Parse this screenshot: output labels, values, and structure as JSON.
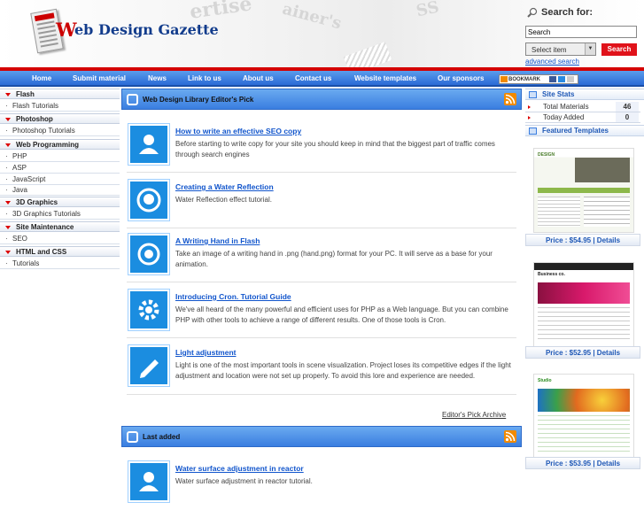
{
  "header": {
    "logo_w": "W",
    "logo_rest": "eb Design Gazette",
    "bg_words": [
      "ertise",
      "ainer's",
      "SS"
    ],
    "search_title": "Search for:",
    "search_value": "Search",
    "select_value": "Select item",
    "search_button": "Search",
    "advanced_search": "advanced search"
  },
  "nav": {
    "items": [
      "Home",
      "Submit material",
      "News",
      "Link to us",
      "About us",
      "Contact us",
      "Website templates",
      "Our sponsors"
    ],
    "bookmark": "BOOKMARK"
  },
  "sidebar": {
    "categories": [
      {
        "label": "Flash",
        "items": [
          "Flash Tutorials"
        ]
      },
      {
        "label": "Photoshop",
        "items": [
          "Photoshop Tutorials"
        ]
      },
      {
        "label": "Web Programming",
        "items": [
          "PHP",
          "ASP",
          "JavaScript",
          "Java"
        ]
      },
      {
        "label": "3D Graphics",
        "items": [
          "3D Graphics Tutorials"
        ]
      },
      {
        "label": "Site Maintenance",
        "items": [
          "SEO"
        ]
      },
      {
        "label": "HTML and CSS",
        "items": [
          "Tutorials"
        ]
      }
    ]
  },
  "main": {
    "editors_pick_title": "Web Design Library Editor's Pick",
    "articles": [
      {
        "title": "How to write an effective SEO copy",
        "desc": "Before starting to write copy for your site you should keep in mind that the biggest part of traffic comes through search engines",
        "icon": "user-icon"
      },
      {
        "title": "Creating a Water Reflection",
        "desc": "Water Reflection effect tutorial.",
        "icon": "face-icon"
      },
      {
        "title": "A Writing Hand in Flash",
        "desc": "Take an image of a writing hand in .png (hand.png) format for your PC. It will serve as a base for your animation.",
        "icon": "refresh-icon"
      },
      {
        "title": "Introducing Cron. Tutorial Guide",
        "desc": "We've all heard of the many powerful and efficient uses for PHP as a Web language. But you can combine PHP with other tools to achieve a range of different results. One of those tools is Cron.",
        "icon": "gear-icon"
      },
      {
        "title": "Light adjustment",
        "desc": "Light is one of the most important tools in scene visualization. Project loses its competitive edges if the light adjustment and location were not set up properly. To avoid this lore and experience are needed.",
        "icon": "pencil-icon"
      }
    ],
    "archive_link": "Editor's Pick Archive",
    "last_added_title": "Last added",
    "last_added": [
      {
        "title": "Water surface adjustment in reactor",
        "desc": "Water surface adjustment in reactor tutorial.",
        "icon": "user-icon"
      }
    ]
  },
  "right": {
    "stats_title": "Site Stats",
    "stats": [
      {
        "label": "Total Materials",
        "value": "46"
      },
      {
        "label": "Today Added",
        "value": "0"
      }
    ],
    "featured_title": "Featured Templates",
    "templates": [
      {
        "price": "Price : $54.95",
        "details": "Details",
        "brand": "DESIGN"
      },
      {
        "price": "Price : $52.95",
        "details": "Details",
        "brand": "Business co."
      },
      {
        "price": "Price : $53.95",
        "details": "Details",
        "brand": "Studio"
      }
    ]
  }
}
